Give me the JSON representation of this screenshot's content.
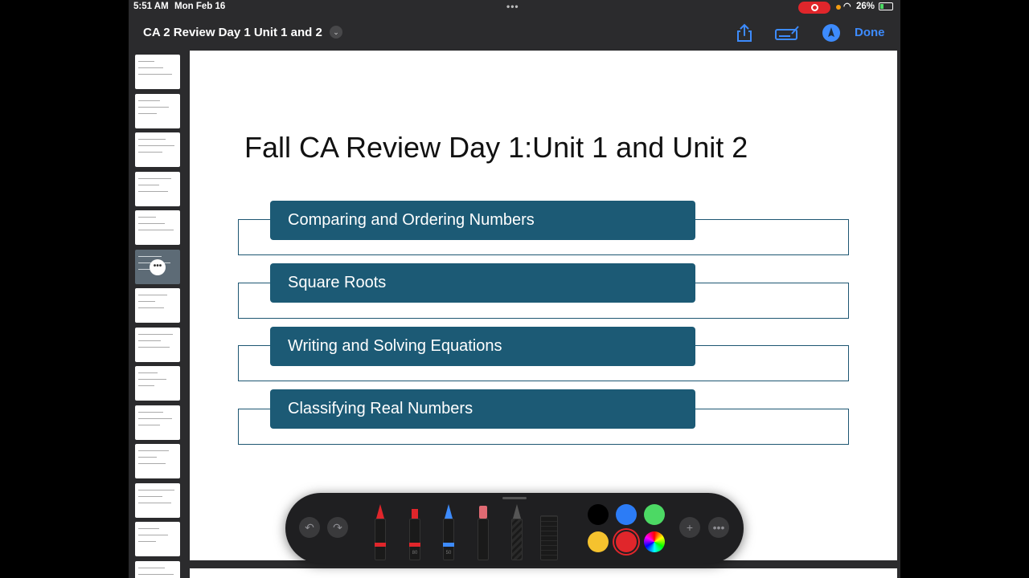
{
  "status": {
    "time": "5:51 AM",
    "date": "Mon Feb 16",
    "battery": "26%"
  },
  "navbar": {
    "title": "CA 2 Review Day 1 Unit 1 and 2",
    "done_label": "Done",
    "icons": [
      "share-icon",
      "markup-toolbar-icon",
      "pencil-circle-icon"
    ]
  },
  "thumbnails": {
    "selected_index": 5,
    "count": 14
  },
  "slide": {
    "title": "Fall CA Review Day 1:Unit 1 and Unit 2",
    "topics": [
      "Comparing and Ordering Numbers",
      "Square Roots",
      "Writing and Solving Equations",
      "Classifying Real Numbers"
    ],
    "colors": {
      "topic_fill": "#1c5a75",
      "frame_border": "#1d5672"
    }
  },
  "markup_toolbar": {
    "tools": [
      {
        "name": "pen",
        "color": "#e0262b",
        "label": ""
      },
      {
        "name": "marker",
        "color": "#e0262b",
        "label": "80"
      },
      {
        "name": "pencil",
        "color": "#3d8bfd",
        "label": "50"
      },
      {
        "name": "eraser",
        "color": "#e06a73",
        "label": ""
      },
      {
        "name": "lasso",
        "color": "#555555",
        "label": ""
      },
      {
        "name": "ruler",
        "color": "#333333",
        "label": ""
      }
    ],
    "colors": [
      "#000000",
      "#2c7cf6",
      "#4cd964",
      "#f5c22e",
      "#e0262b",
      "color-wheel"
    ],
    "selected_color": "#e0262b"
  }
}
